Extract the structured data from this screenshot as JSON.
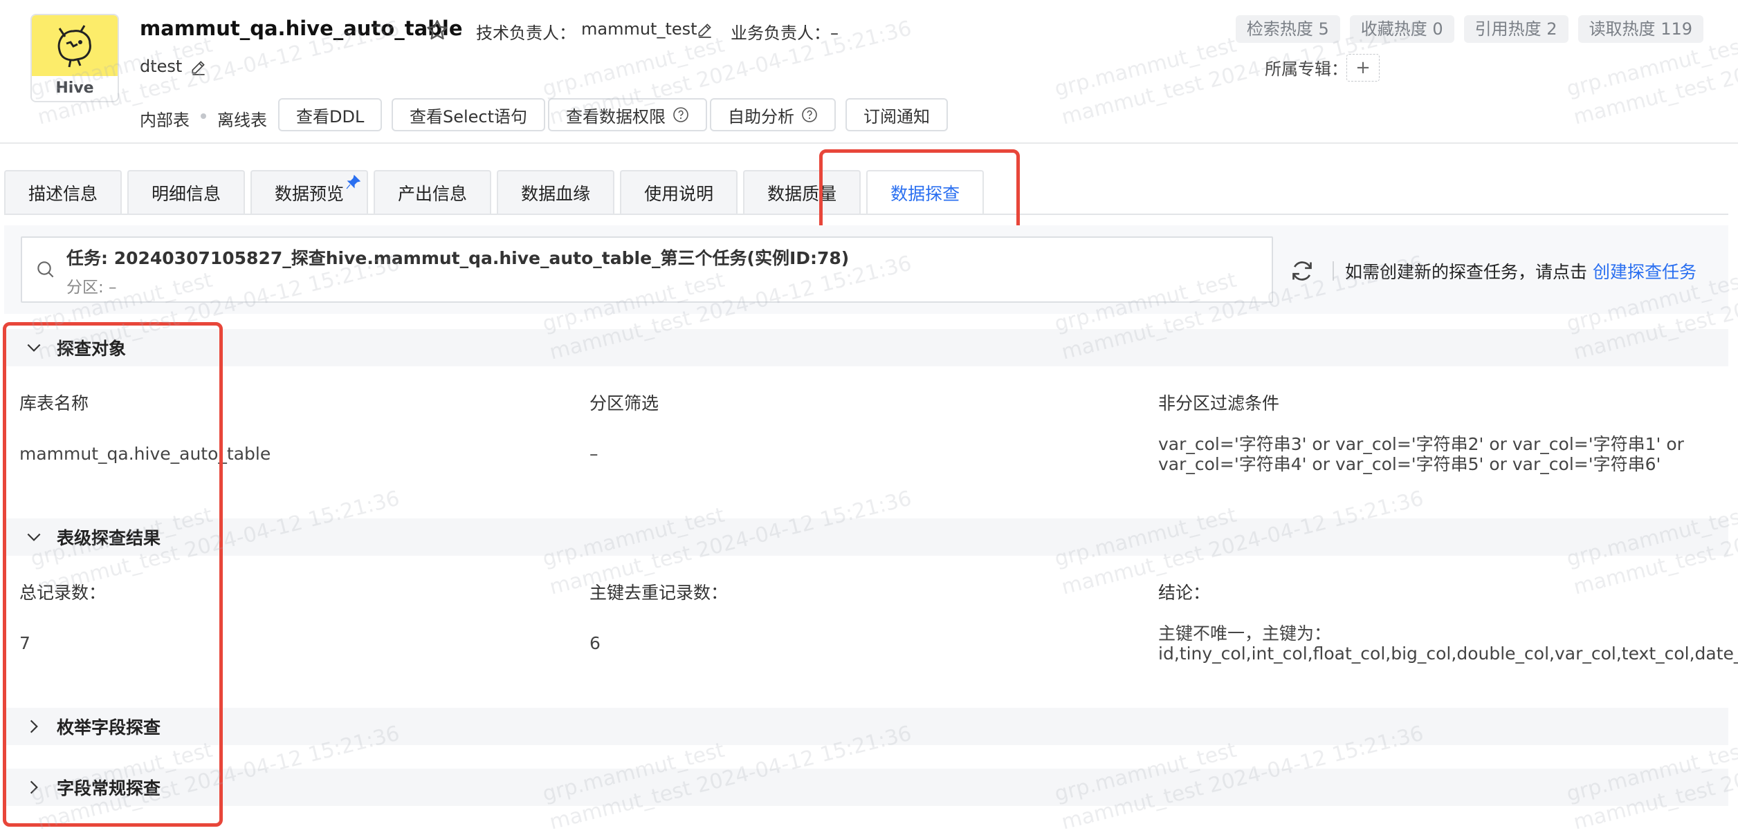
{
  "header": {
    "logo_label": "Hive",
    "table_name": "mammut_qa.hive_auto_table",
    "tech_owner_label": "技术负责人：",
    "tech_owner": "mammut_test",
    "biz_owner_label": "业务负责人：–",
    "database": "dtest",
    "heat": [
      "检索热度 5",
      "收藏热度 0",
      "引用热度 2",
      "读取热度 119"
    ],
    "topic_label": "所属专辑：",
    "topic_add": "+",
    "tags": [
      "内部表",
      "离线表"
    ],
    "buttons": {
      "ddl": "查看DDL",
      "select": "查看Select语句",
      "permission": "查看数据权限",
      "analysis": "自助分析",
      "subscribe": "订阅通知"
    }
  },
  "tabs": [
    "描述信息",
    "明细信息",
    "数据预览",
    "产出信息",
    "数据血缘",
    "使用说明",
    "数据质量",
    "数据探查"
  ],
  "active_tab": "数据探查",
  "task": {
    "title": "任务: 20240307105827_探查hive.mammut_qa.hive_auto_table_第三个任务(实例ID:78)",
    "partition": "分区: –",
    "hint": "如需创建新的探查任务，请点击",
    "create_link": "创建探查任务"
  },
  "sections": {
    "object": {
      "title": "探查对象",
      "col1_label": "库表名称",
      "col1_value": "mammut_qa.hive_auto_table",
      "col2_label": "分区筛选",
      "col2_value": "–",
      "col3_label": "非分区过滤条件",
      "col3_value": "var_col='字符串3' or var_col='字符串2' or var_col='字符串1' or var_col='字符串4' or var_col='字符串5' or var_col='字符串6'"
    },
    "table_result": {
      "title": "表级探查结果",
      "col1_label": "总记录数：",
      "col1_value": "7",
      "col2_label": "主键去重记录数：",
      "col2_value": "6",
      "col3_label": "结论：",
      "col3_value": "主键不唯一，主键为：id,tiny_col,int_col,float_col,big_col,double_col,var_col,text_col,date_col"
    },
    "enum": {
      "title": "枚举字段探查"
    },
    "regular": {
      "title": "字段常规探查"
    }
  },
  "watermark": {
    "user": "grp.mammut_test",
    "stamp": "mammut_test 2024-04-12 15:21:36"
  },
  "colors": {
    "accent": "#2a6ff0",
    "highlight": "#e8463a",
    "logo_bg": "#fcec6a"
  }
}
